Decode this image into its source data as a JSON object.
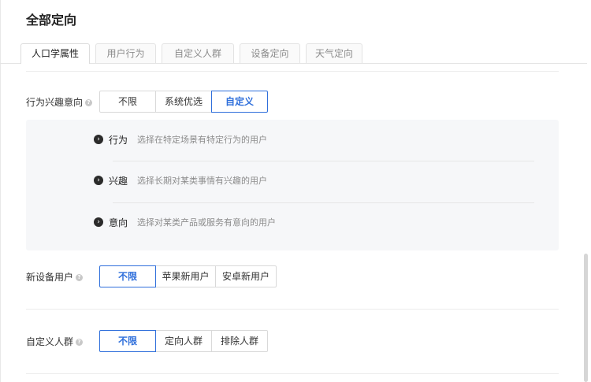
{
  "page_title": "全部定向",
  "tabs": [
    {
      "label": "人口学属性",
      "active": true
    },
    {
      "label": "用户行为",
      "active": false
    },
    {
      "label": "自定义人群",
      "active": false
    },
    {
      "label": "设备定向",
      "active": false
    },
    {
      "label": "天气定向",
      "active": false
    }
  ],
  "behavior_interest": {
    "label": "行为兴趣意向",
    "options": [
      "不限",
      "系统优选",
      "自定义"
    ],
    "selected": "自定义",
    "custom_items": [
      {
        "title": "行为",
        "desc": "选择在特定场景有特定行为的用户"
      },
      {
        "title": "兴趣",
        "desc": "选择长期对某类事情有兴趣的用户"
      },
      {
        "title": "意向",
        "desc": "选择对某类产品或服务有意向的用户"
      }
    ]
  },
  "new_device_user": {
    "label": "新设备用户",
    "options": [
      "不限",
      "苹果新用户",
      "安卓新用户"
    ],
    "selected": "不限"
  },
  "custom_audience": {
    "label": "自定义人群",
    "options": [
      "不限",
      "定向人群",
      "排除人群"
    ],
    "selected": "不限"
  },
  "colors": {
    "accent": "#2f6fdb",
    "panel_bg": "#f6f7f9"
  },
  "icons": {
    "help": "question-circle-icon",
    "option": "chevron-right-circle-icon"
  }
}
